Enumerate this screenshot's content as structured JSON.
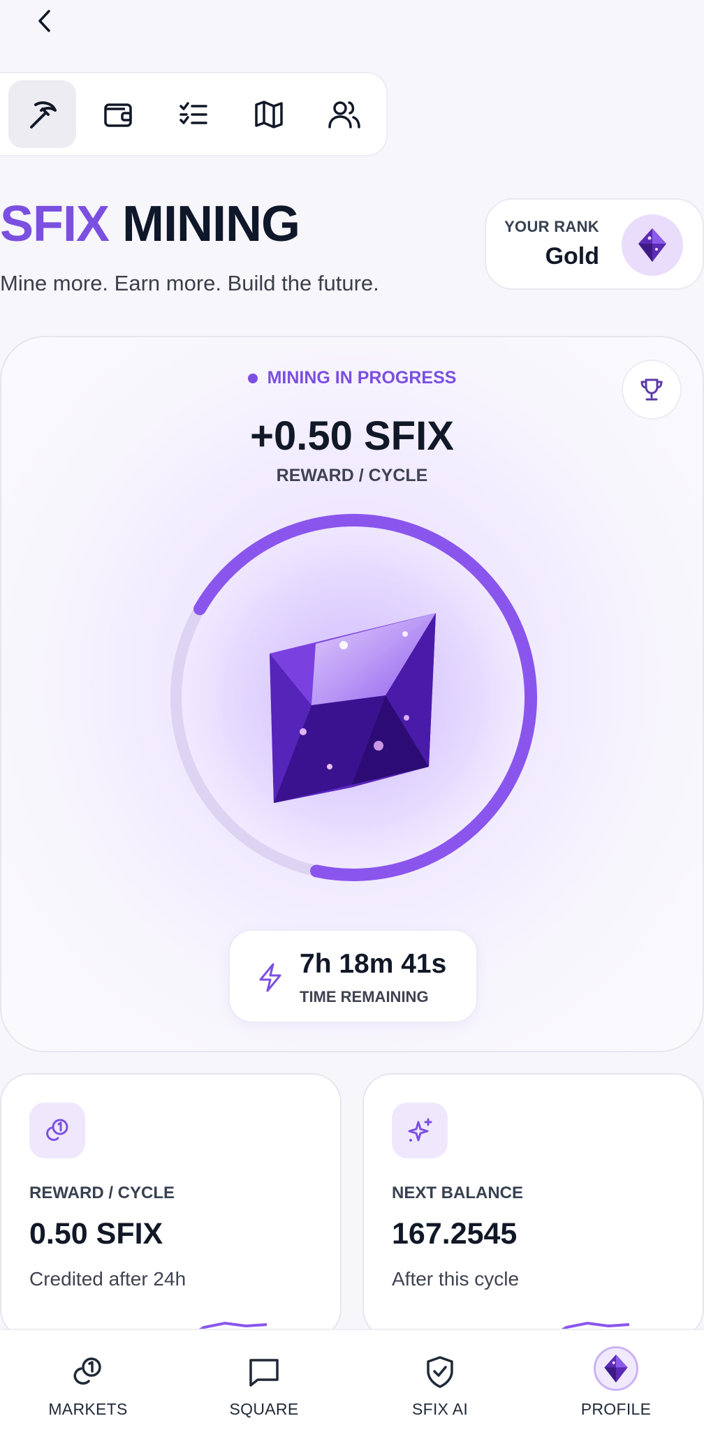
{
  "header": {
    "back_icon": "chevron-left-icon"
  },
  "toolbar": {
    "items": [
      {
        "icon": "pickaxe-icon",
        "active": true
      },
      {
        "icon": "wallet-icon",
        "active": false
      },
      {
        "icon": "checklist-icon",
        "active": false
      },
      {
        "icon": "map-icon",
        "active": false
      },
      {
        "icon": "users-icon",
        "active": false
      }
    ]
  },
  "hero": {
    "title_accent": "SFIX",
    "title_rest": "MINING",
    "tagline": "Mine more. Earn more. Build the future."
  },
  "rank": {
    "label": "YOUR RANK",
    "value": "Gold",
    "badge_icon": "diamond-gem-icon"
  },
  "mining": {
    "status": "MINING IN PROGRESS",
    "reward_amount": "+0.50 SFIX",
    "reward_label": "REWARD / CYCLE",
    "progress": 0.7,
    "trophy_icon": "trophy-icon",
    "timer_value": "7h 18m 41s",
    "timer_label": "TIME REMAINING",
    "timer_icon": "lightning-icon"
  },
  "stats": [
    {
      "icon": "coins-icon",
      "label": "REWARD / CYCLE",
      "value": "0.50 SFIX",
      "sub": "Credited after 24h"
    },
    {
      "icon": "sparkles-icon",
      "label": "NEXT BALANCE",
      "value": "167.2545",
      "sub": "After this cycle"
    }
  ],
  "bottom_nav": [
    {
      "icon": "coins-icon",
      "label": "MARKETS"
    },
    {
      "icon": "chat-bubble-icon",
      "label": "SQUARE"
    },
    {
      "icon": "shield-check-icon",
      "label": "SFIX AI"
    },
    {
      "icon": "avatar-gem-icon",
      "label": "PROFILE"
    }
  ],
  "colors": {
    "accent": "#7b4fe0",
    "background": "#f6f6fb",
    "text": "#111827"
  }
}
